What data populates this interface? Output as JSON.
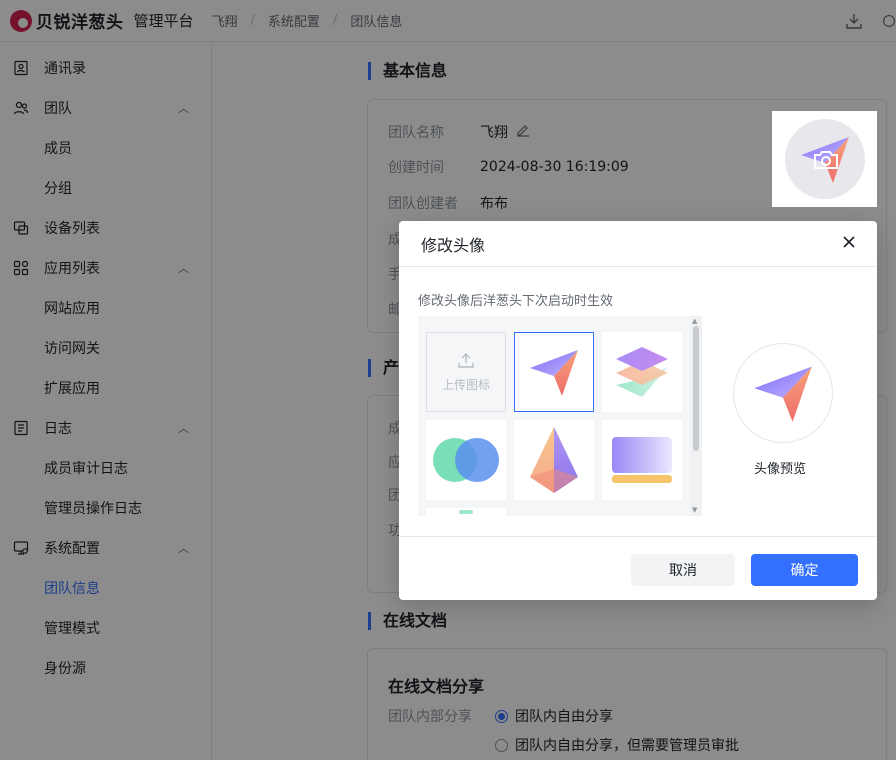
{
  "topbar": {
    "brand": "贝锐洋葱头",
    "platform": "管理平台",
    "breadcrumb": [
      "飞翔",
      "系统配置",
      "团队信息"
    ],
    "breadcrumb_sep": "/"
  },
  "sidebar": {
    "items": [
      {
        "label": "通讯录",
        "icon": "contacts-icon"
      },
      {
        "label": "团队",
        "icon": "team-icon",
        "expanded": true
      },
      {
        "label": "成员",
        "sub": true
      },
      {
        "label": "分组",
        "sub": true
      },
      {
        "label": "设备列表",
        "icon": "devices-icon"
      },
      {
        "label": "应用列表",
        "icon": "apps-icon",
        "expanded": true
      },
      {
        "label": "网站应用",
        "sub": true
      },
      {
        "label": "访问网关",
        "sub": true
      },
      {
        "label": "扩展应用",
        "sub": true
      },
      {
        "label": "日志",
        "icon": "log-icon",
        "expanded": true
      },
      {
        "label": "成员审计日志",
        "sub": true
      },
      {
        "label": "管理员操作日志",
        "sub": true
      },
      {
        "label": "系统配置",
        "icon": "settings-monitor-icon",
        "expanded": true
      },
      {
        "label": "团队信息",
        "sub": true,
        "active": true
      },
      {
        "label": "管理模式",
        "sub": true
      },
      {
        "label": "身份源",
        "sub": true
      }
    ]
  },
  "main": {
    "basic_title": "基本信息",
    "team_name_label": "团队名称",
    "team_name": "飞翔",
    "created_label": "创建时间",
    "created_value": "2024-08-30 16:19:09",
    "creator_label": "团队创建者",
    "creator_value": "布布",
    "partial_labels": [
      "成",
      "手",
      "邮"
    ],
    "product_title_partial": "产",
    "product_partial_labels": [
      "成",
      "应",
      "团",
      "功"
    ],
    "online_doc_title": "在线文档",
    "online_doc_share_title": "在线文档分享",
    "internal_share_label": "团队内部分享",
    "share_options": [
      {
        "label": "团队内自由分享",
        "checked": true
      },
      {
        "label": "团队内自由分享，但需要管理员审批",
        "checked": false
      }
    ]
  },
  "modal": {
    "title": "修改头像",
    "tip": "修改头像后洋葱头下次启动时生效",
    "upload_label": "上传图标",
    "preview_label": "头像预览",
    "cancel_label": "取消",
    "ok_label": "确定"
  },
  "colors": {
    "accent": "#3370ff",
    "brand": "#d6204e"
  }
}
